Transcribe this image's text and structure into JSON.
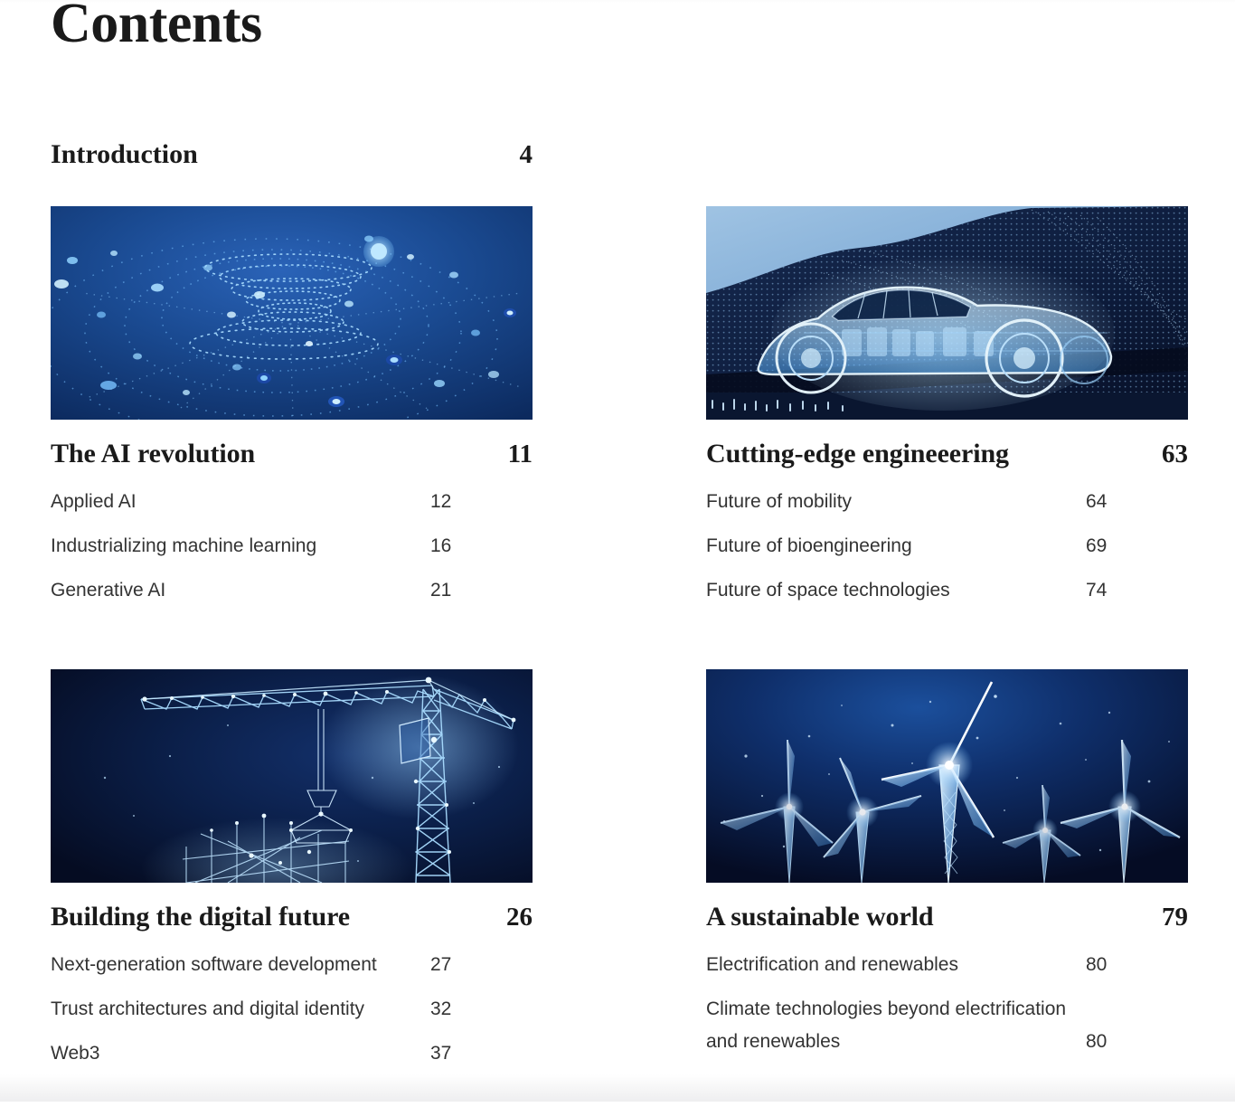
{
  "document": {
    "title": "Contents"
  },
  "introduction": {
    "label": "Introduction",
    "page": "4"
  },
  "sections": [
    {
      "title": "The AI revolution",
      "page": "11",
      "image_name": "ai-network-particles-thumbnail",
      "image_alt": "Abstract blue particle network with concentric dotted rings",
      "items": [
        {
          "label": "Applied AI",
          "page": "12"
        },
        {
          "label": "Industrializing machine learning",
          "page": "16"
        },
        {
          "label": "Generative AI",
          "page": "21"
        }
      ]
    },
    {
      "title": "Cutting-edge engineeering",
      "page": "63",
      "image_name": "wireframe-car-thumbnail",
      "image_alt": "Glowing wireframe car on a dotted terrain mesh",
      "items": [
        {
          "label": "Future of mobility",
          "page": "64"
        },
        {
          "label": "Future of bioengineering",
          "page": "69"
        },
        {
          "label": "Future of space technologies",
          "page": "74"
        }
      ]
    },
    {
      "title": "Building the digital future",
      "page": "26",
      "image_name": "wireframe-crane-thumbnail",
      "image_alt": "Low-poly glowing tower crane over a building frame",
      "items": [
        {
          "label": "Next-generation software development",
          "page": "27"
        },
        {
          "label": "Trust architectures and digital identity",
          "page": "32"
        },
        {
          "label": "Web3",
          "page": "37"
        }
      ]
    },
    {
      "title": "A sustainable world",
      "page": "79",
      "image_name": "wireframe-wind-turbines-thumbnail",
      "image_alt": "Five glowing low-poly wind turbines on dark blue",
      "items": [
        {
          "label": "Electrification and renewables",
          "page": "80"
        },
        {
          "label": "Climate technologies beyond electrification and renewables",
          "page": "80"
        }
      ]
    }
  ],
  "colors": {
    "text": "#1a1a1a",
    "subtext": "#333333",
    "thumb_deep_navy": "#081530",
    "thumb_blue": "#1d4f9e",
    "thumb_glow": "#9fd8ff"
  }
}
